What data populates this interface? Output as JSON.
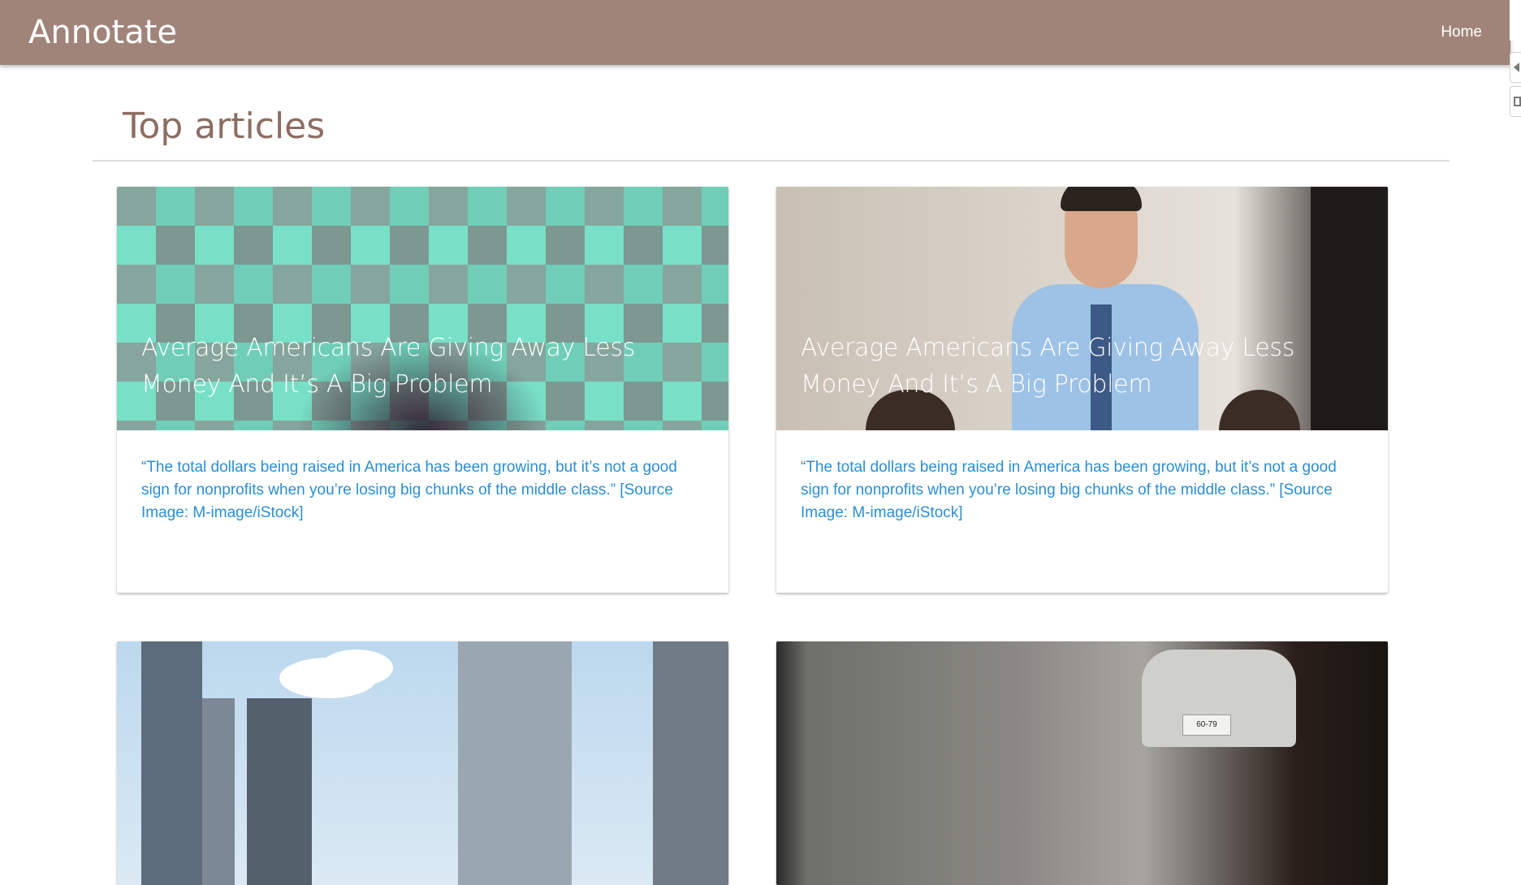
{
  "header": {
    "brand": "Annotate",
    "nav": {
      "home_label": "Home"
    },
    "bar_color": "#a0847a"
  },
  "main": {
    "section_title": "Top articles",
    "articles": [
      {
        "title": "Average Americans Are Giving Away Less Money And It’s A Big Problem",
        "summary": "“The total dollars being raised in America has been growing, but it’s not a good sign for nonprofits when you’re losing big chunks of the middle class.” [Source Image: M-image/iStock]",
        "image": "green-isometric-cubes"
      },
      {
        "title": "Average Americans Are Giving Away Less Money And It’s A Big Problem",
        "summary": "“The total dollars being raised in America has been growing, but it’s not a good sign for nonprofits when you’re losing big chunks of the middle class.” [Source Image: M-image/iStock]",
        "image": "man-in-office"
      },
      {
        "title": "",
        "summary": "",
        "image": "city-skyline"
      },
      {
        "title": "",
        "summary": "",
        "image": "car-in-garage",
        "plate_text": "60-79"
      }
    ]
  },
  "accent_colors": {
    "title": "#8d6e63",
    "summary_link": "#2a8dd4"
  }
}
